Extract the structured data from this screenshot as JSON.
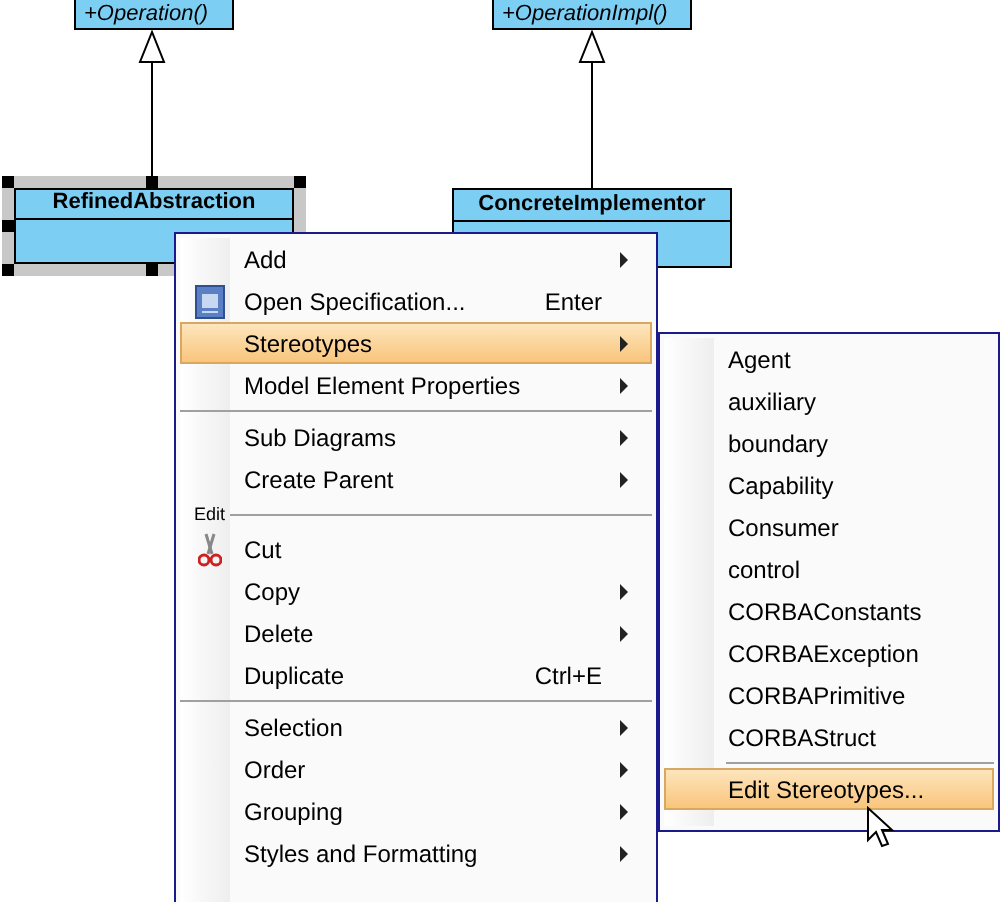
{
  "diagram": {
    "classes": [
      {
        "operation": "+Operation()",
        "kind": "cut-top",
        "selected": false
      },
      {
        "operation": "+OperationImpl()",
        "kind": "cut-top",
        "selected": false
      },
      {
        "name": "RefinedAbstraction",
        "kind": "full",
        "selected": true
      },
      {
        "name": "ConcreteImplementor",
        "kind": "full",
        "selected": false
      }
    ]
  },
  "context_menu": {
    "items": [
      {
        "kind": "item",
        "label": "Add",
        "submenu": true,
        "selected": false
      },
      {
        "kind": "item",
        "label": "Open Specification...",
        "shortcut": "Enter",
        "submenu": false,
        "selected": false
      },
      {
        "kind": "item",
        "label": "Stereotypes",
        "submenu": true,
        "selected": true
      },
      {
        "kind": "item",
        "label": "Model Element Properties",
        "submenu": true,
        "selected": false
      },
      {
        "kind": "separator"
      },
      {
        "kind": "item",
        "label": "Sub Diagrams",
        "submenu": true,
        "selected": false
      },
      {
        "kind": "item",
        "label": "Create Parent",
        "submenu": true,
        "selected": false
      },
      {
        "kind": "section",
        "label": "Edit"
      },
      {
        "kind": "item",
        "label": "Cut",
        "submenu": false,
        "selected": false
      },
      {
        "kind": "item",
        "label": "Copy",
        "submenu": true,
        "selected": false
      },
      {
        "kind": "item",
        "label": "Delete",
        "submenu": true,
        "selected": false
      },
      {
        "kind": "item",
        "label": "Duplicate",
        "shortcut": "Ctrl+E",
        "submenu": false,
        "selected": false
      },
      {
        "kind": "separator"
      },
      {
        "kind": "item",
        "label": "Selection",
        "submenu": true,
        "selected": false
      },
      {
        "kind": "item",
        "label": "Order",
        "submenu": true,
        "selected": false
      },
      {
        "kind": "item",
        "label": "Grouping",
        "submenu": true,
        "selected": false
      },
      {
        "kind": "item",
        "label": "Styles and Formatting",
        "submenu": true,
        "selected": false
      }
    ]
  },
  "stereotypes_submenu": {
    "items": [
      {
        "kind": "item",
        "label": "Agent",
        "selected": false
      },
      {
        "kind": "item",
        "label": "auxiliary",
        "selected": false
      },
      {
        "kind": "item",
        "label": "boundary",
        "selected": false
      },
      {
        "kind": "item",
        "label": "Capability",
        "selected": false
      },
      {
        "kind": "item",
        "label": "Consumer",
        "selected": false
      },
      {
        "kind": "item",
        "label": "control",
        "selected": false
      },
      {
        "kind": "item",
        "label": "CORBAConstants",
        "selected": false
      },
      {
        "kind": "item",
        "label": "CORBAException",
        "selected": false
      },
      {
        "kind": "item",
        "label": "CORBAPrimitive",
        "selected": false
      },
      {
        "kind": "item",
        "label": "CORBAStruct",
        "selected": false
      },
      {
        "kind": "separator"
      },
      {
        "kind": "item",
        "label": "Edit Stereotypes...",
        "selected": true
      }
    ]
  }
}
